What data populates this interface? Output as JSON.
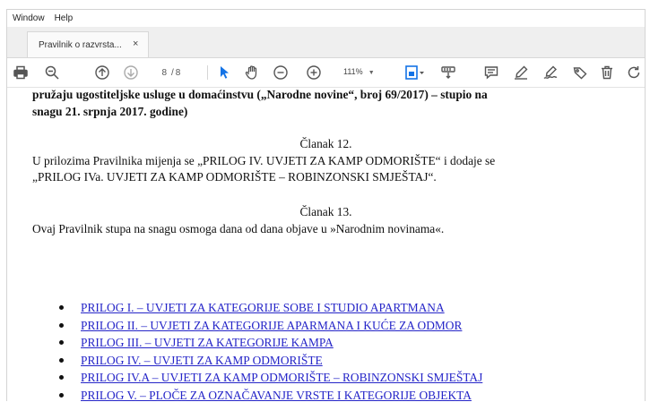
{
  "menu": {
    "window": "Window",
    "help": "Help"
  },
  "tab": {
    "title": "Pravilnik o razvrsta...",
    "close": "×"
  },
  "toolbar": {
    "page_current": "8",
    "page_separator": "/",
    "page_total": "8",
    "zoom": "111%",
    "icons": [
      "print-icon",
      "search-icon",
      "page-up-icon",
      "page-down-icon",
      "select-arrow-icon",
      "hand-icon",
      "zoom-out-icon",
      "zoom-in-icon",
      "fit-page-icon",
      "scroll-mode-icon",
      "comment-icon",
      "highlight-pen-icon",
      "sign-icon",
      "stamp-icon",
      "delete-icon",
      "rotate-icon"
    ]
  },
  "document": {
    "intro_line1": "pružaju ugostiteljske usluge u domaćinstvu („Narodne novine“, broj  69/2017) – stupio na",
    "intro_line2": "snagu 21. srpnja 2017. godine)",
    "article12_heading": "Članak 12.",
    "article12_line1": "U prilozima Pravilnika mijenja se „PRILOG IV. UVJETI ZA KAMP ODMORIŠTE“ i dodaje se",
    "article12_line2": "„PRILOG IVa. UVJETI ZA KAMP ODMORIŠTE – ROBINZONSKI SMJEŠTAJ“.",
    "article13_heading": "Članak 13.",
    "article13_line1": "Ovaj Pravilnik stupa na snagu osmoga dana od dana objave u »Narodnim novinama«.",
    "links": [
      "PRILOG I. – UVJETI ZA KATEGORIJE SOBE I STUDIO APARTMANA",
      "PRILOG II. – UVJETI ZA KATEGORIJE APARMANA I KUĆE ZA ODMOR",
      "PRILOG III. – UVJETI ZA KATEGORIJE KAMPA",
      "PRILOG IV. – UVJETI ZA KAMP ODMORIŠTE",
      "PRILOG IV.A – UVJETI ZA KAMP ODMORIŠTE – ROBINZONSKI SMJEŠTAJ",
      "PRILOG V. – PLOČE ZA OZNAČAVANJE VRSTE I KATEGORIJE OBJEKTA"
    ]
  },
  "colors": {
    "link": "#2525c8",
    "select_active": "#1473e6",
    "icon": "#555555"
  }
}
